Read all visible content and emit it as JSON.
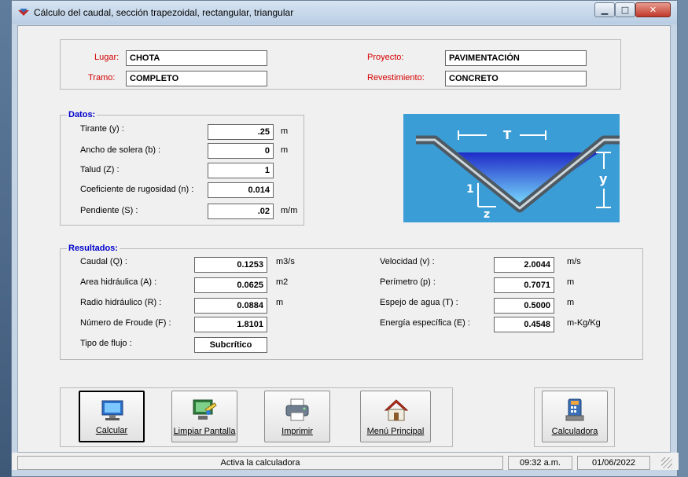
{
  "window": {
    "title": "Cálculo del caudal, sección trapezoidal, rectangular, triangular"
  },
  "project": {
    "lugar": {
      "label": "Lugar:",
      "value": "CHOTA"
    },
    "tramo": {
      "label": "Tramo:",
      "value": "COMPLETO"
    },
    "proyecto": {
      "label": "Proyecto:",
      "value": "PAVIMENTACIÓN"
    },
    "revestimiento": {
      "label": "Revestimiento:",
      "value": "CONCRETO"
    }
  },
  "datos": {
    "legend": "Datos:",
    "tirante": {
      "label": "Tirante (y) :",
      "value": ".25",
      "unit": "m"
    },
    "ancho": {
      "label": "Ancho de solera (b) :",
      "value": "0",
      "unit": "m"
    },
    "talud": {
      "label": "Talud  (Z) :",
      "value": "1"
    },
    "rugosidad": {
      "label": "Coeficiente de rugosidad (n) :",
      "value": "0.014"
    },
    "pendiente": {
      "label": "Pendiente (S) :",
      "value": ".02",
      "unit": "m/m"
    }
  },
  "diagram": {
    "T": "T",
    "y": "y",
    "one": "1",
    "z": "z"
  },
  "resultados": {
    "legend": "Resultados:",
    "caudal": {
      "label": "Caudal (Q) :",
      "value": "0.1253",
      "unit": "m3/s"
    },
    "area": {
      "label": "Area hidráulica (A) :",
      "value": "0.0625",
      "unit": "m2"
    },
    "radio": {
      "label": "Radio hidráulico (R) :",
      "value": "0.0884",
      "unit": "m"
    },
    "froude": {
      "label": "Número de Froude (F) :",
      "value": "1.8101"
    },
    "tipo": {
      "label": "Tipo de flujo :",
      "value": "Subcrítico"
    },
    "velocidad": {
      "label": "Velocidad (v) :",
      "value": "2.0044",
      "unit": "m/s"
    },
    "perimetro": {
      "label": "Perímetro (p) :",
      "value": "0.7071",
      "unit": "m"
    },
    "espejo": {
      "label": "Espejo de agua (T) :",
      "value": "0.5000",
      "unit": "m"
    },
    "energia": {
      "label": "Energía específica (E) :",
      "value": "0.4548",
      "unit": "m-Kg/Kg"
    }
  },
  "buttons": {
    "calcular": "Calcular",
    "limpiar": "Limpiar Pantalla",
    "imprimir": "Imprimir",
    "menu": "Menú Principal",
    "calculadora": "Calculadora"
  },
  "status": {
    "message": "Activa la calculadora",
    "time": "09:32 a.m.",
    "date": "01/06/2022"
  }
}
